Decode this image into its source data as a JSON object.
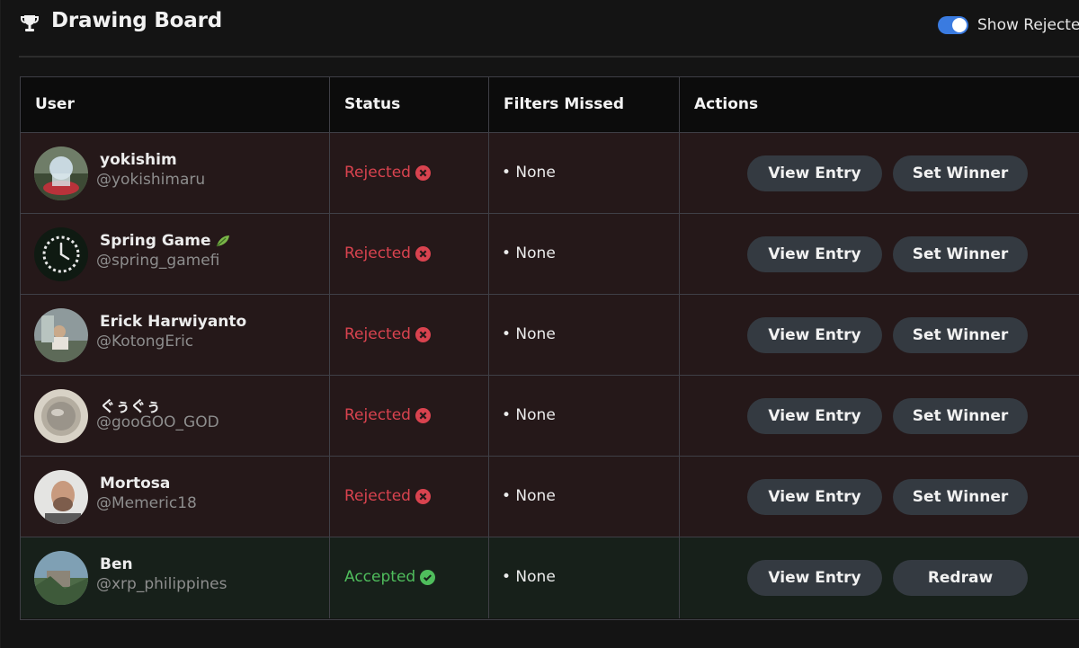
{
  "header": {
    "title": "Drawing Board",
    "toggle_label": "Show Rejecte",
    "toggle_on": true,
    "accent_color": "#3a7be0"
  },
  "table": {
    "columns": [
      "User",
      "Status",
      "Filters Missed",
      "Actions"
    ],
    "rows": [
      {
        "name": "yokishim",
        "handle": "@yokishimaru",
        "status": "Rejected",
        "filters": "• None",
        "view_label": "View Entry",
        "action_label": "Set Winner",
        "avatar": "avatar-photo-icon"
      },
      {
        "name": "Spring Game",
        "handle": "@spring_gamefi",
        "status": "Rejected",
        "filters": "• None",
        "view_label": "View Entry",
        "action_label": "Set Winner",
        "avatar": "clock-logo-icon",
        "name_emoji": "leaf-icon"
      },
      {
        "name": "Erick Harwiyanto",
        "handle": "@KotongEric",
        "status": "Rejected",
        "filters": "• None",
        "view_label": "View Entry",
        "action_label": "Set Winner",
        "avatar": "avatar-photo-icon"
      },
      {
        "name": "ぐぅぐぅ",
        "handle": "@gooGOO_GOD",
        "status": "Rejected",
        "filters": "• None",
        "view_label": "View Entry",
        "action_label": "Set Winner",
        "avatar": "avatar-photo-icon"
      },
      {
        "name": "Mortosa",
        "handle": "@Memeric18",
        "status": "Rejected",
        "filters": "• None",
        "view_label": "View Entry",
        "action_label": "Set Winner",
        "avatar": "avatar-photo-icon"
      },
      {
        "name": "Ben",
        "handle": "@xrp_philippines",
        "status": "Accepted",
        "filters": "• None",
        "view_label": "View Entry",
        "action_label": "Redraw",
        "avatar": "avatar-photo-icon"
      }
    ]
  },
  "colors": {
    "rejected": "#d9434f",
    "accepted": "#4fbd5c",
    "rejected_row": "#251819",
    "accepted_row": "#17201a",
    "button": "#343a41"
  }
}
